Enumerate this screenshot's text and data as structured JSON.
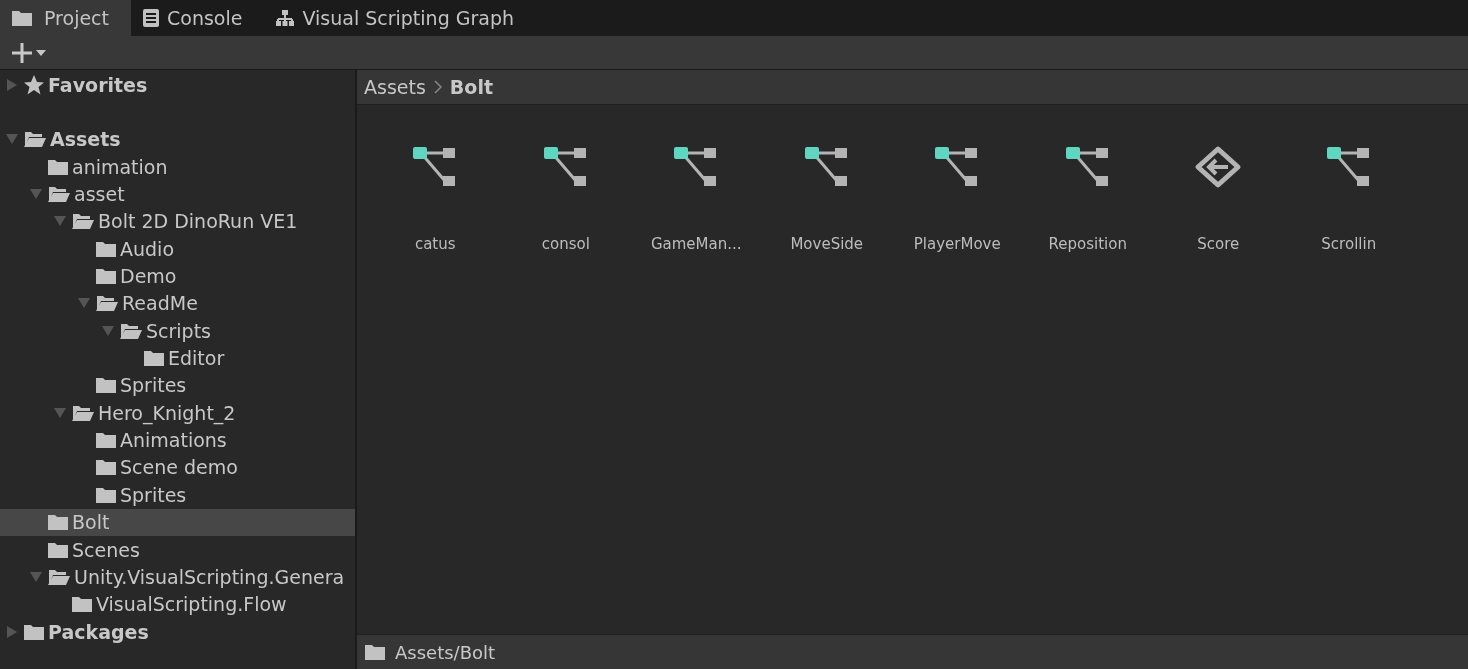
{
  "tabs": [
    {
      "label": "Project",
      "selected": true
    },
    {
      "label": "Console",
      "selected": false
    },
    {
      "label": "Visual Scripting Graph",
      "selected": false
    }
  ],
  "toolbar": {
    "add_button": true
  },
  "tree": [
    {
      "label": "Favorites",
      "kind": "favorites",
      "expanded": false,
      "selected": false
    },
    {
      "label": "Assets",
      "kind": "branch",
      "expanded": true,
      "selected": false,
      "children": [
        {
          "label": "animation",
          "kind": "leaf",
          "expanded": false,
          "selected": false
        },
        {
          "label": "asset",
          "kind": "branch",
          "expanded": true,
          "selected": false,
          "children": [
            {
              "label": "Bolt 2D DinoRun VE1",
              "kind": "branch",
              "expanded": true,
              "selected": false,
              "children": [
                {
                  "label": "Audio",
                  "kind": "leaf",
                  "expanded": false,
                  "selected": false
                },
                {
                  "label": "Demo",
                  "kind": "leaf",
                  "expanded": false,
                  "selected": false
                },
                {
                  "label": "ReadMe",
                  "kind": "branch",
                  "expanded": true,
                  "selected": false,
                  "children": [
                    {
                      "label": "Scripts",
                      "kind": "branch",
                      "expanded": true,
                      "selected": false,
                      "children": [
                        {
                          "label": "Editor",
                          "kind": "leaf",
                          "expanded": false,
                          "selected": false
                        }
                      ]
                    }
                  ]
                },
                {
                  "label": "Sprites",
                  "kind": "leaf",
                  "expanded": false,
                  "selected": false
                }
              ]
            },
            {
              "label": "Hero_Knight_2",
              "kind": "branch",
              "expanded": true,
              "selected": false,
              "children": [
                {
                  "label": "Animations",
                  "kind": "leaf",
                  "expanded": false,
                  "selected": false
                },
                {
                  "label": "Scene demo",
                  "kind": "leaf",
                  "expanded": false,
                  "selected": false
                },
                {
                  "label": "Sprites",
                  "kind": "leaf",
                  "expanded": false,
                  "selected": false
                }
              ]
            }
          ]
        },
        {
          "label": "Bolt",
          "kind": "leaf",
          "expanded": false,
          "selected": true
        },
        {
          "label": "Scenes",
          "kind": "leaf",
          "expanded": false,
          "selected": false
        },
        {
          "label": "Unity.VisualScripting.Genera",
          "kind": "branch",
          "expanded": true,
          "selected": false,
          "children": [
            {
              "label": "VisualScripting.Flow",
              "kind": "leaf",
              "expanded": false,
              "selected": false
            }
          ]
        }
      ]
    },
    {
      "label": "Packages",
      "kind": "branch",
      "expanded": false,
      "selected": false
    }
  ],
  "breadcrumb": [
    "Assets",
    "Bolt"
  ],
  "assets": [
    {
      "label": "catus",
      "kind": "graph"
    },
    {
      "label": "consol",
      "kind": "graph"
    },
    {
      "label": "GameMan...",
      "kind": "graph"
    },
    {
      "label": "MoveSide",
      "kind": "graph"
    },
    {
      "label": "PlayerMove",
      "kind": "graph"
    },
    {
      "label": "Reposition",
      "kind": "graph"
    },
    {
      "label": "Score",
      "kind": "macro"
    },
    {
      "label": "Scrollin",
      "kind": "graph"
    }
  ],
  "status_bar": {
    "path": "Assets/Bolt"
  }
}
